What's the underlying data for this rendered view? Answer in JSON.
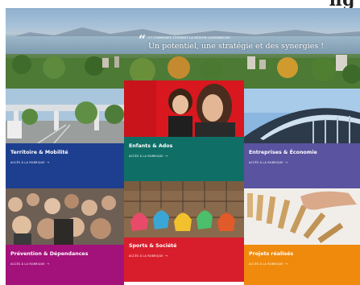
{
  "header": {
    "partial_title": "ng"
  },
  "hero": {
    "quote_glyph": "“",
    "small_text": "27 communes forment la Région lausannoise",
    "main_text": "Un potentiel, une stratégie et des synergies !"
  },
  "tiles": [
    {
      "title": "Territoire & Mobilité",
      "link": "Accès à la rubrique",
      "color": "#1e3f8f"
    },
    {
      "title": "Enfants & Ados",
      "link": "Accès à la rubrique",
      "color": "#0f6f67"
    },
    {
      "title": "Entreprises & Économie",
      "link": "Accès à la rubrique",
      "color": "#5a53a0"
    },
    {
      "title": "Prévention & Dépendances",
      "link": "Accès à la rubrique",
      "color": "#a3117a"
    },
    {
      "title": "Sports & Société",
      "link": "Accès à la rubrique",
      "color": "#d81e2c"
    },
    {
      "title": "Projets réalisés",
      "link": "Accès à la rubrique",
      "color": "#ef8a0c"
    }
  ],
  "icons": {
    "arrow": "arrow-right-icon",
    "quote": "quote-icon"
  }
}
